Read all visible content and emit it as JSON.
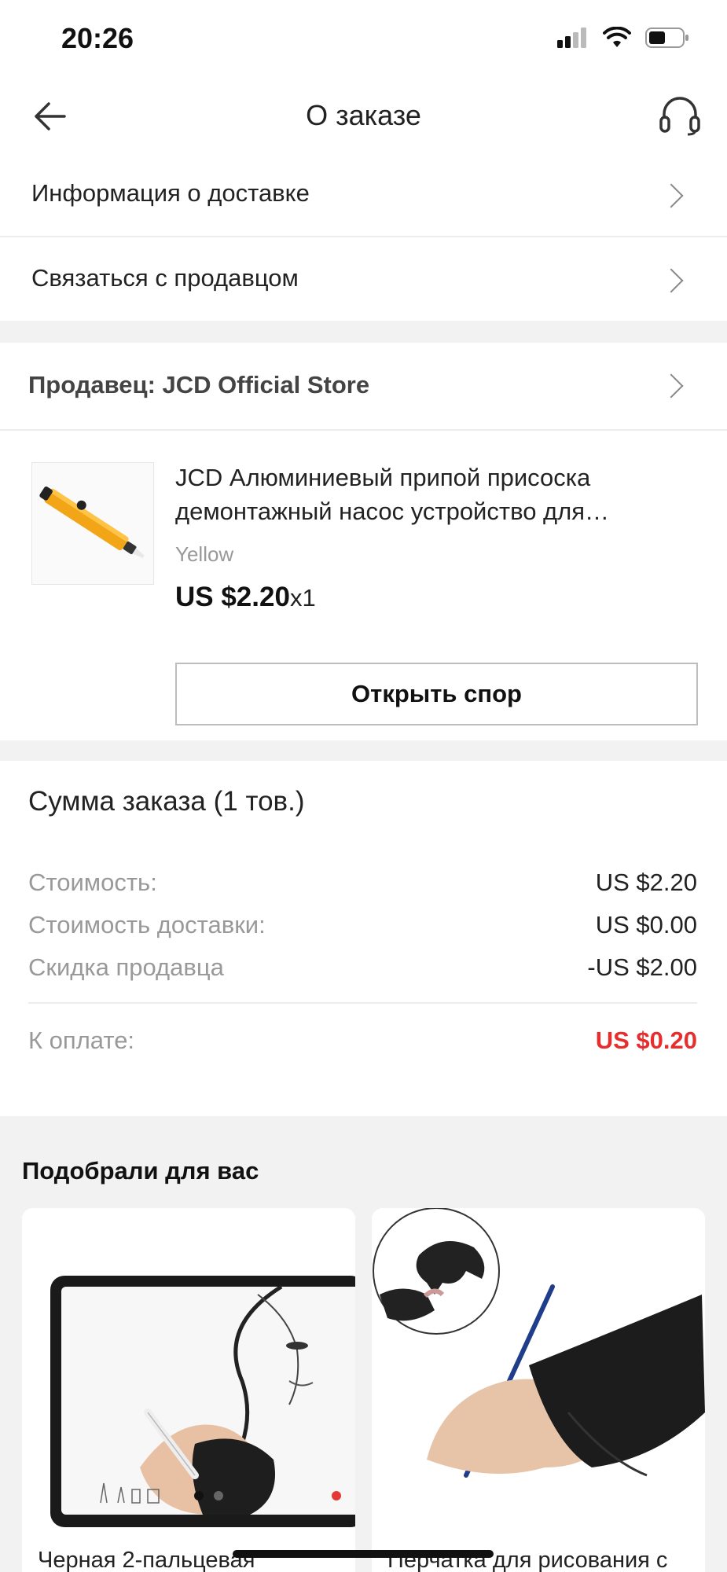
{
  "status_bar": {
    "time": "20:26"
  },
  "header": {
    "title": "О заказе"
  },
  "menu": {
    "delivery_info": "Информация о доставке",
    "contact_seller": "Связаться с продавцом"
  },
  "seller": {
    "label": "Продавец: JCD Official Store"
  },
  "product": {
    "title": "JCD Алюминиевый припой присоска демонтажный насос устройство для удаления припоя",
    "variant": "Yellow",
    "price": "US $2.20",
    "quantity": "x1",
    "dispute_button": "Открыть спор"
  },
  "summary": {
    "title": "Сумма заказа (1 тов.)",
    "rows": [
      {
        "label": "Стоимость:",
        "value": "US $2.20"
      },
      {
        "label": "Стоимость доставки:",
        "value": "US $0.00"
      },
      {
        "label": "Скидка продавца",
        "value": "-US $2.00"
      }
    ],
    "total": {
      "label": "К оплате:",
      "value": "US $0.20"
    }
  },
  "recommendations": {
    "title": "Подобрали для вас",
    "items": [
      {
        "name": "Черная 2-пальцевая"
      },
      {
        "name": "Перчатка для рисования с"
      }
    ]
  },
  "colors": {
    "accent": "#e62e2e",
    "background_gap": "#f2f2f2",
    "product_orange": "#f2a516"
  }
}
